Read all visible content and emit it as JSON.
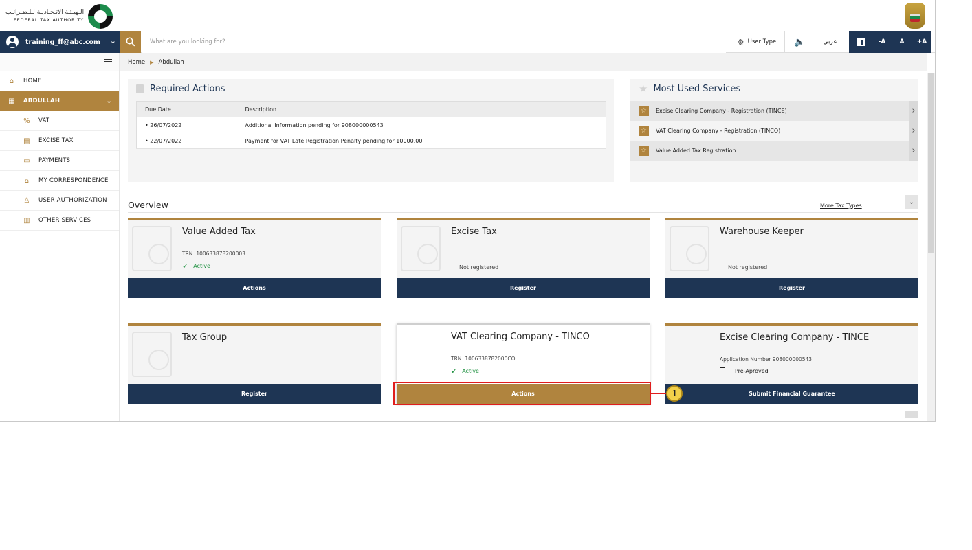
{
  "brand": {
    "name_ar": "الـهيـئـة الاتـحـاديـة لـلـضـرائـب",
    "name_en": "FEDERAL TAX AUTHORITY"
  },
  "nav": {
    "user_email": "training_ff@abc.com",
    "search_placeholder": "What are you looking for?",
    "user_type_label": "User Type",
    "sound_icon": "🔈",
    "arabic_label": "عربي",
    "font_decrease": "-A",
    "font_reset": "A",
    "font_increase": "+A"
  },
  "sidebar": {
    "items": [
      {
        "label": "HOME",
        "icon": "home-icon"
      },
      {
        "label": "ABDULLAH",
        "icon": "grid-icon"
      },
      {
        "label": "VAT",
        "icon": "vat-icon"
      },
      {
        "label": "EXCISE TAX",
        "icon": "excise-icon"
      },
      {
        "label": "PAYMENTS",
        "icon": "card-icon"
      },
      {
        "label": "MY CORRESPONDENCE",
        "icon": "mailbox-icon"
      },
      {
        "label": "USER AUTHORIZATION",
        "icon": "user-auth-icon"
      },
      {
        "label": "OTHER SERVICES",
        "icon": "document-icon"
      }
    ]
  },
  "breadcrumb": {
    "home": "Home",
    "current": "Abdullah"
  },
  "required_actions": {
    "title": "Required Actions",
    "columns": [
      "Due Date",
      "Description"
    ],
    "rows": [
      {
        "date": "• 26/07/2022",
        "description": "Additional Information pending for 908000000543"
      },
      {
        "date": "• 22/07/2022",
        "description": "Payment for VAT Late Registration Penalty pending for 10000.00"
      }
    ]
  },
  "most_used": {
    "title": "Most Used Services",
    "items": [
      "Excise Clearing Company - Registration (TINCE)",
      "VAT Clearing Company - Registration (TINCO)",
      "Value Added Tax Registration"
    ]
  },
  "overview": {
    "title": "Overview",
    "more_link": "More Tax Types",
    "cards": [
      {
        "title": "Value Added Tax",
        "trn": "TRN :100633878200003",
        "status": "Active",
        "button": "Actions"
      },
      {
        "title": "Excise Tax",
        "status": "Not registered",
        "button": "Register"
      },
      {
        "title": "Warehouse Keeper",
        "status": "Not registered",
        "button": "Register"
      },
      {
        "title": "Tax Group",
        "button": "Register"
      },
      {
        "title": "VAT Clearing Company - TINCO",
        "trn": "TRN :1006338782000CO",
        "status": "Active",
        "button": "Actions"
      },
      {
        "title": "Excise Clearing Company - TINCE",
        "trn": "Application Number 908000000543",
        "status": "Pre-Aproved",
        "button": "Submit Financial Guarantee"
      }
    ]
  },
  "callout": {
    "number": "1"
  },
  "colors": {
    "navy": "#1e3554",
    "gold": "#b0843e",
    "active_green": "#1a8f3c",
    "highlight_red": "#e01d1d"
  }
}
